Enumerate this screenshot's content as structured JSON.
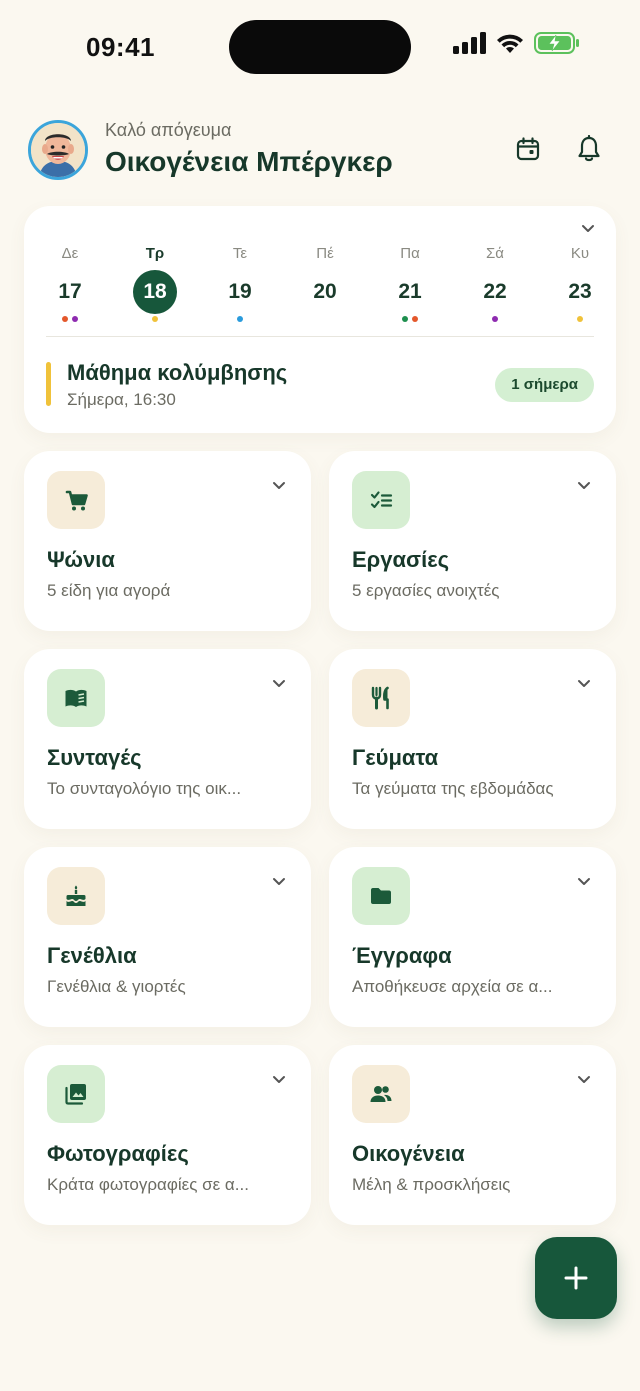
{
  "status_bar": {
    "time": "09:41"
  },
  "header": {
    "greeting": "Καλό απόγευμα",
    "family_name": "Οικογένεια Μπέργκερ"
  },
  "calendar": {
    "days": [
      {
        "name": "Δε",
        "num": "17",
        "selected": false,
        "dots": [
          "#E4582C",
          "#8E2BB0"
        ]
      },
      {
        "name": "Τρ",
        "num": "18",
        "selected": true,
        "dots": [
          "#F0C23A"
        ]
      },
      {
        "name": "Τε",
        "num": "19",
        "selected": false,
        "dots": [
          "#2A9BDC"
        ]
      },
      {
        "name": "Πέ",
        "num": "20",
        "selected": false,
        "dots": []
      },
      {
        "name": "Πα",
        "num": "21",
        "selected": false,
        "dots": [
          "#1E8F4E",
          "#E4582C"
        ]
      },
      {
        "name": "Σά",
        "num": "22",
        "selected": false,
        "dots": [
          "#8E2BB0"
        ]
      },
      {
        "name": "Κυ",
        "num": "23",
        "selected": false,
        "dots": [
          "#F0C23A"
        ]
      }
    ],
    "event": {
      "title": "Μάθημα κολύμβησης",
      "time": "Σήμερα, 16:30",
      "badge": "1 σήμερα"
    }
  },
  "cards": [
    {
      "title": "Ψώνια",
      "subtitle": "5 είδη για αγορά",
      "icon": "cart-icon",
      "tone": "beige"
    },
    {
      "title": "Εργασίες",
      "subtitle": "5 εργασίες ανοιχτές",
      "icon": "checklist-icon",
      "tone": "green"
    },
    {
      "title": "Συνταγές",
      "subtitle": "Το συνταγολόγιο της οικ...",
      "icon": "book-icon",
      "tone": "green"
    },
    {
      "title": "Γεύματα",
      "subtitle": "Τα γεύματα της εβδομάδας",
      "icon": "cutlery-icon",
      "tone": "beige"
    },
    {
      "title": "Γενέθλια",
      "subtitle": "Γενέθλια & γιορτές",
      "icon": "cake-icon",
      "tone": "beige"
    },
    {
      "title": "Έγγραφα",
      "subtitle": "Αποθήκευσε αρχεία σε α...",
      "icon": "folder-icon",
      "tone": "green"
    },
    {
      "title": "Φωτογραφίες",
      "subtitle": "Κράτα φωτογραφίες σε α...",
      "icon": "photos-icon",
      "tone": "green"
    },
    {
      "title": "Οικογένεια",
      "subtitle": "Μέλη & προσκλήσεις",
      "icon": "people-icon",
      "tone": "beige"
    }
  ],
  "colors": {
    "primary": "#17573B",
    "background": "#FBF8F0",
    "event_bar": "#F0C23A",
    "badge_bg": "#D4EFD2"
  }
}
